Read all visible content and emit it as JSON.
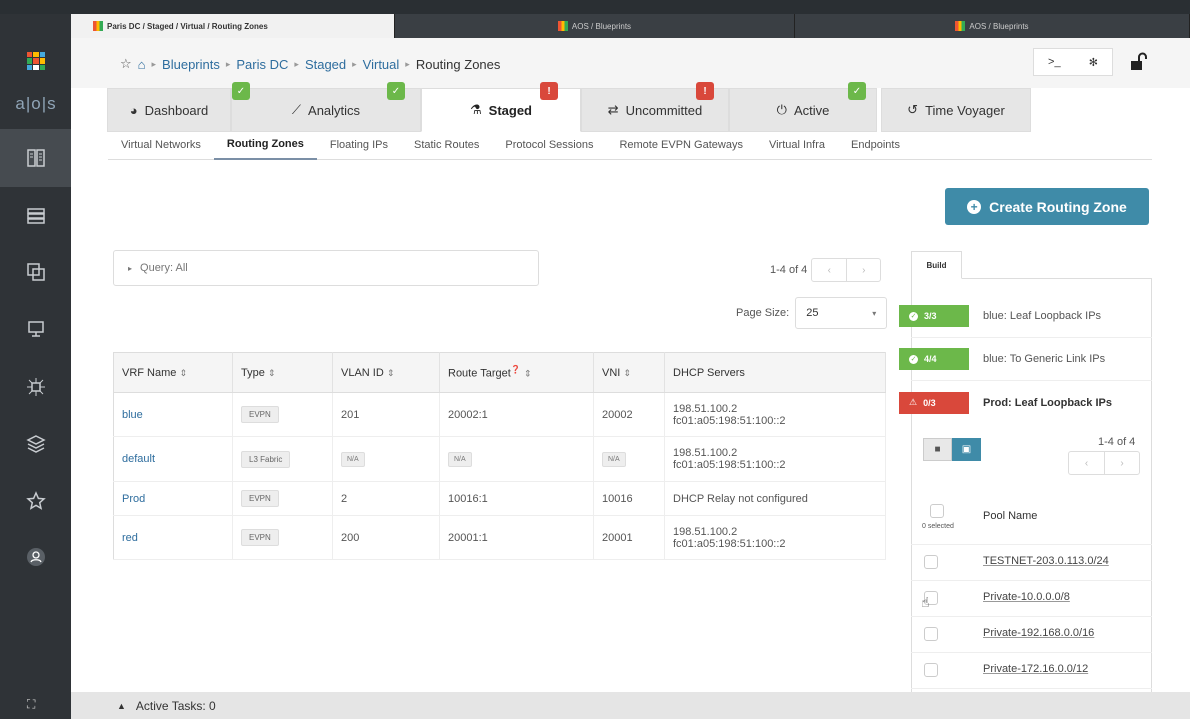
{
  "browser_tabs": [
    {
      "label": "Paris DC / Staged / Virtual / Routing Zones"
    },
    {
      "label": "AOS / Blueprints"
    },
    {
      "label": "AOS / Blueprints"
    }
  ],
  "logo": {
    "text": "a|o|s"
  },
  "breadcrumb": {
    "items": [
      "Blueprints",
      "Paris DC",
      "Staged",
      "Virtual"
    ],
    "current": "Routing Zones"
  },
  "tools": {
    "cli": ">_",
    "bug": "✻"
  },
  "tabs": [
    {
      "label": "Dashboard",
      "icon": "palette-icon",
      "badge": "ok"
    },
    {
      "label": "Analytics",
      "icon": "chart-icon",
      "badge": "ok"
    },
    {
      "label": "Staged",
      "icon": "flask-icon",
      "badge": "warn"
    },
    {
      "label": "Uncommitted",
      "icon": "arrows-icon",
      "badge": "warn"
    },
    {
      "label": "Active",
      "icon": "power-icon",
      "badge": "ok"
    },
    {
      "label": "Time Voyager",
      "icon": "history-icon"
    }
  ],
  "subtabs": [
    "Virtual Networks",
    "Routing Zones",
    "Floating IPs",
    "Static Routes",
    "Protocol Sessions",
    "Remote EVPN Gateways",
    "Virtual Infra",
    "Endpoints"
  ],
  "create_button": "Create Routing Zone",
  "query": "Query: All",
  "pager": {
    "text": "1-4 of 4"
  },
  "page_size": {
    "label": "Page Size:",
    "value": "25"
  },
  "table": {
    "headers": [
      "VRF Name",
      "Type",
      "VLAN ID",
      "Route Target",
      "VNI",
      "DHCP Servers"
    ],
    "rows": [
      {
        "vrf": "blue",
        "type": "EVPN",
        "vlan": "201",
        "rt": "20002:1",
        "vni": "20002",
        "dhcp1": "198.51.100.2",
        "dhcp2": "fc01:a05:198:51:100::2"
      },
      {
        "vrf": "default",
        "type": "L3 Fabric",
        "vlan": "N/A",
        "rt": "N/A",
        "vni": "N/A",
        "dhcp1": "198.51.100.2",
        "dhcp2": "fc01:a05:198:51:100::2"
      },
      {
        "vrf": "Prod",
        "type": "EVPN",
        "vlan": "2",
        "rt": "10016:1",
        "vni": "10016",
        "dhcp1": "DHCP Relay not configured",
        "dhcp2": ""
      },
      {
        "vrf": "red",
        "type": "EVPN",
        "vlan": "200",
        "rt": "20001:1",
        "vni": "20001",
        "dhcp1": "198.51.100.2",
        "dhcp2": "fc01:a05:198:51:100::2"
      }
    ]
  },
  "build": {
    "tab": "Build",
    "items": [
      {
        "count": "3/3",
        "label": "blue: Leaf Loopback IPs",
        "status": "ok"
      },
      {
        "count": "4/4",
        "label": "blue: To Generic Link IPs",
        "status": "ok"
      },
      {
        "count": "0/3",
        "label": "Prod: Leaf Loopback IPs",
        "status": "warn"
      }
    ],
    "pager": "1-4 of 4",
    "selected": "0 selected",
    "column": "Pool Name",
    "pools": [
      "TESTNET-203.0.113.0/24",
      "Private-10.0.0.0/8",
      "Private-192.168.0.0/16",
      "Private-172.16.0.0/12"
    ]
  },
  "status_bar": {
    "label": "Active Tasks: 0"
  },
  "colors": {
    "accent": "#3f8ba8",
    "ok": "#6cb84a",
    "warn": "#d9483b",
    "sidebar": "#2f3337"
  }
}
